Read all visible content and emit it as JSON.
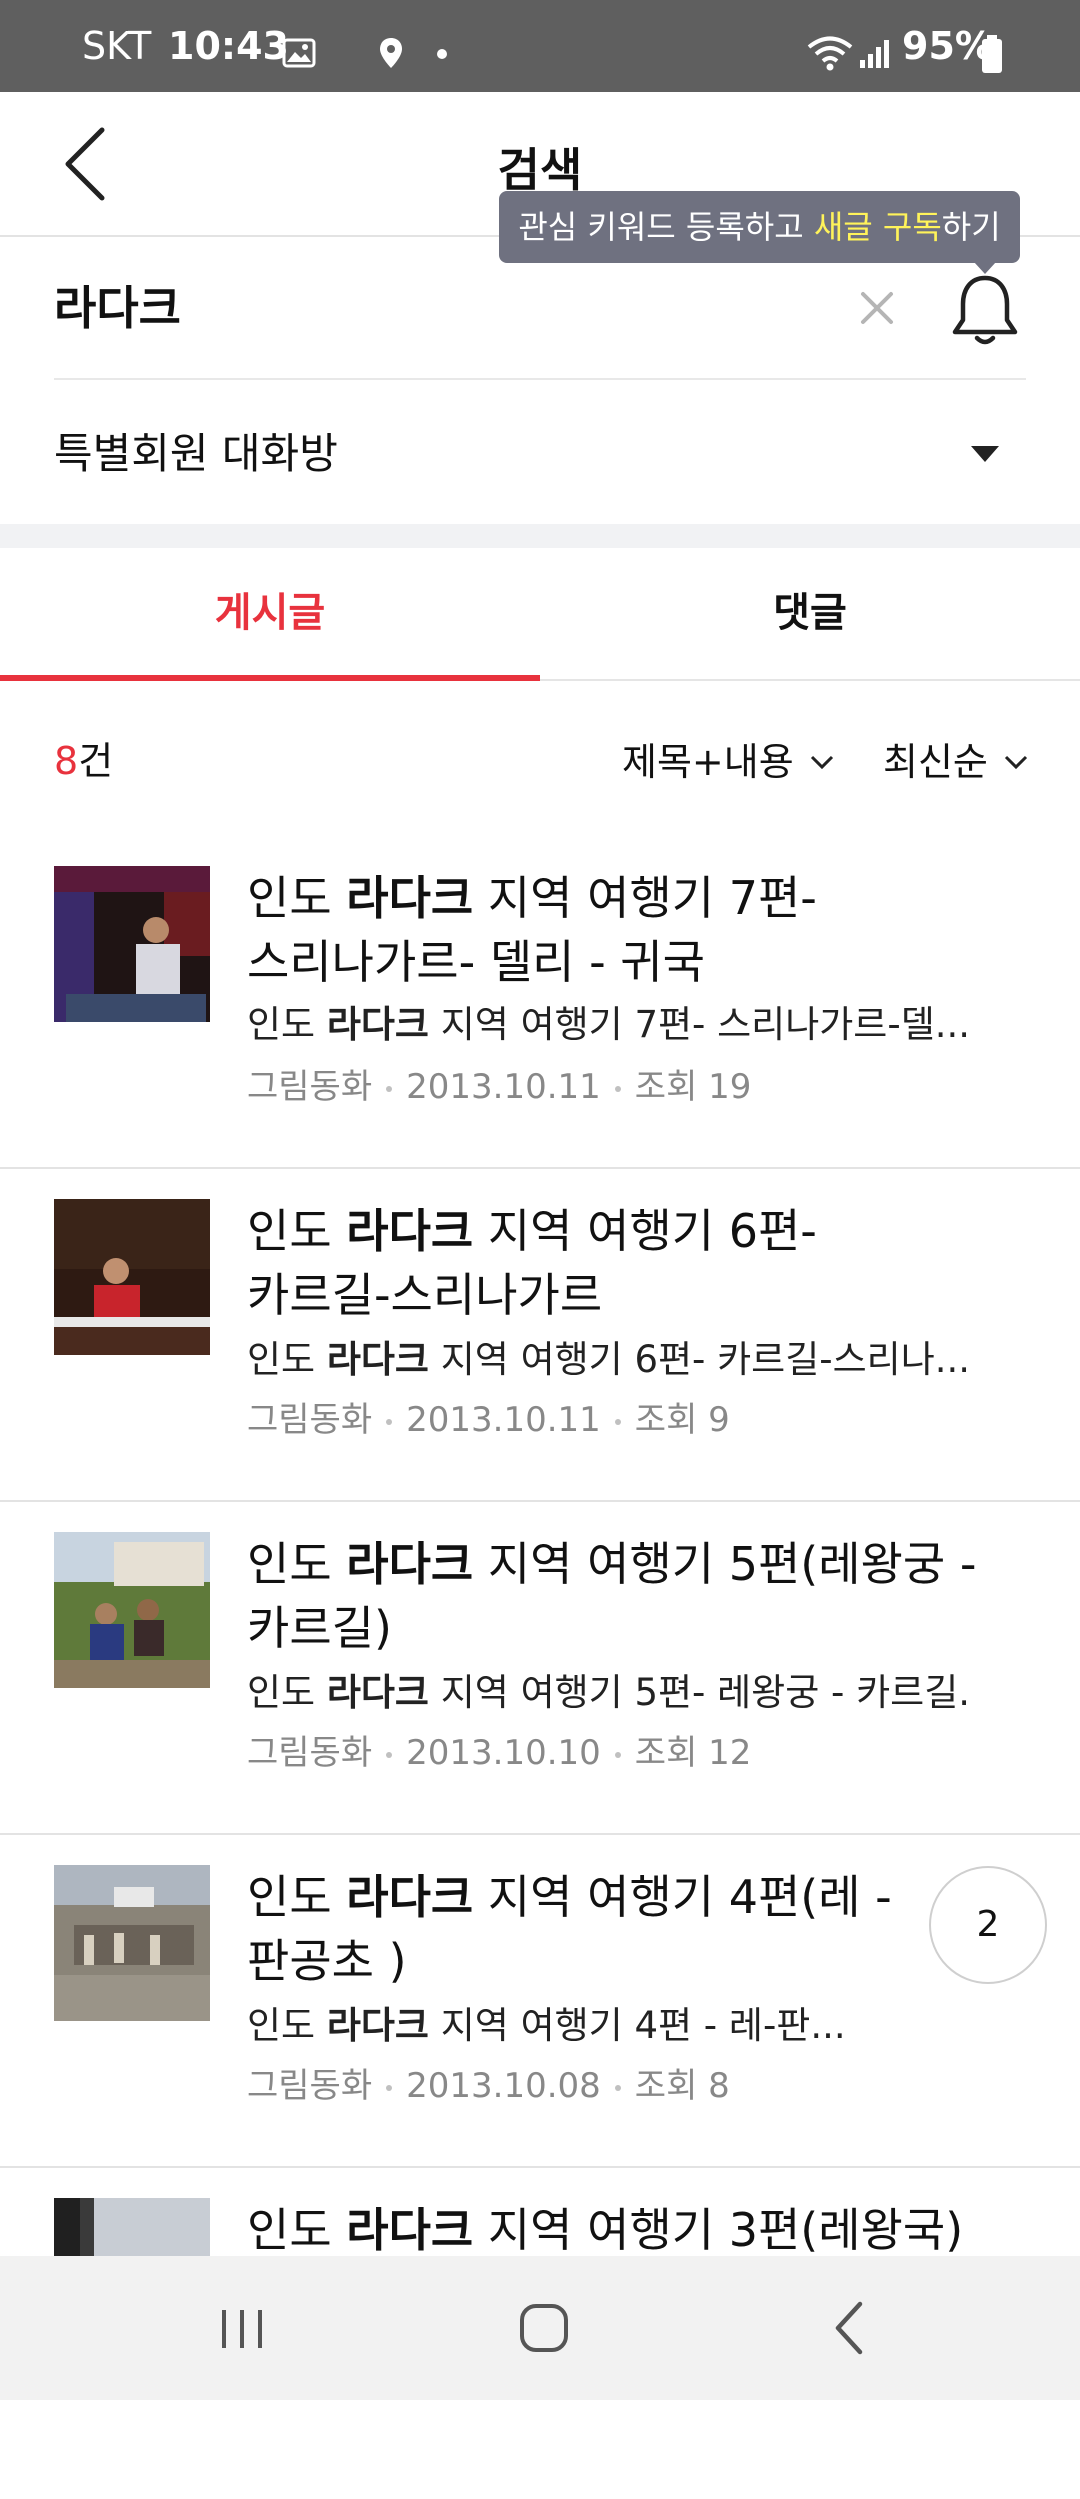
{
  "status_bar": {
    "carrier": "SKT",
    "time": "10:43",
    "battery": "95%"
  },
  "header": {
    "title": "검색",
    "back_icon": "chevron-left-icon"
  },
  "tooltip": {
    "text_before": "관심 키워드 등록하고 ",
    "highlight": "새글 구독",
    "text_after": "하기"
  },
  "search": {
    "query": "라다크"
  },
  "filter": {
    "label": "특별회원 대화방"
  },
  "tabs": [
    {
      "label": "게시글",
      "active": true
    },
    {
      "label": "댓글",
      "active": false
    }
  ],
  "results": {
    "count_number": "8",
    "count_suffix": "건",
    "sort_scope": "제목+내용",
    "sort_order": "최신순"
  },
  "posts": [
    {
      "title_pre": "인도 ",
      "title_bold": "라다크",
      "title_post": " 지역 여행기 7편-",
      "title_line2": "스리나가르- 델리 - 귀국",
      "snippet_pre": "인도 ",
      "snippet_bold": "라다크",
      "snippet_post": " 지역 여행기 7편- 스리나가르-델...",
      "author": "그림동화",
      "date": "2013.10.11",
      "views": "조회 19"
    },
    {
      "title_pre": "인도 ",
      "title_bold": "라다크",
      "title_post": " 지역 여행기 6편-",
      "title_line2": "카르길-스리나가르",
      "snippet_pre": "인도 ",
      "snippet_bold": "라다크",
      "snippet_post": " 지역 여행기 6편- 카르길-스리나...",
      "author": "그림동화",
      "date": "2013.10.11",
      "views": "조회 9"
    },
    {
      "title_pre": "인도 ",
      "title_bold": "라다크",
      "title_post": " 지역 여행기 5편(레왕궁 -",
      "title_line2": "카르길)",
      "snippet_pre": "인도 ",
      "snippet_bold": "라다크",
      "snippet_post": " 지역 여행기 5편- 레왕궁 - 카르길...",
      "author": "그림동화",
      "date": "2013.10.10",
      "views": "조회 12"
    },
    {
      "title_pre": "인도 ",
      "title_bold": "라다크",
      "title_post": " 지역 여행기 4편(레 -",
      "title_line2": "판공초 )",
      "snippet_pre": "인도 ",
      "snippet_bold": "라다크",
      "snippet_post": " 지역 여행기 4편 - 레-판...",
      "author": "그림동화",
      "date": "2013.10.08",
      "views": "조회 8",
      "comment_count": "2"
    },
    {
      "title_pre": "인도 ",
      "title_bold": "라다크",
      "title_post": " 지역 여행기 3편(레왕국)"
    }
  ],
  "colors": {
    "accent": "#e8323d",
    "tooltip_bg": "#6f7180",
    "tooltip_highlight": "#fff35a",
    "status_bar": "#5f5f5f"
  },
  "icons": [
    "chevron-left-icon",
    "close-icon",
    "bell-icon",
    "caret-down-icon",
    "chevron-down-icon",
    "recent-apps-icon",
    "home-icon",
    "back-icon"
  ]
}
